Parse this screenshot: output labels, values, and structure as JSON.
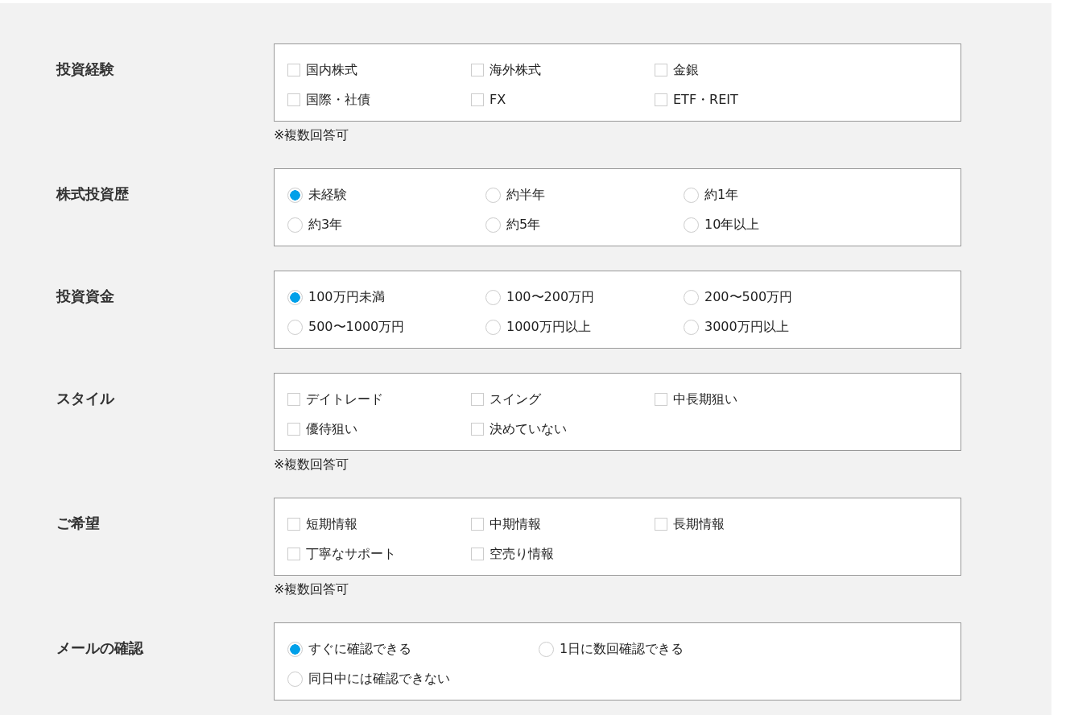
{
  "sections": [
    {
      "label": "投資経験",
      "kind": "checkbox",
      "note": "※複数回答可",
      "options": [
        {
          "label": "国内株式",
          "checked": false
        },
        {
          "label": "海外株式",
          "checked": false
        },
        {
          "label": "金銀",
          "checked": false
        },
        {
          "label": "国際・社債",
          "checked": false
        },
        {
          "label": "FX",
          "checked": false
        },
        {
          "label": "ETF・REIT",
          "checked": false
        }
      ]
    },
    {
      "label": "株式投資歴",
      "kind": "radio",
      "options": [
        {
          "label": "未経験",
          "selected": true
        },
        {
          "label": "約半年",
          "selected": false
        },
        {
          "label": "約1年",
          "selected": false
        },
        {
          "label": "約3年",
          "selected": false
        },
        {
          "label": "約5年",
          "selected": false
        },
        {
          "label": "10年以上",
          "selected": false
        }
      ]
    },
    {
      "label": "投資資金",
      "kind": "radio",
      "options": [
        {
          "label": "100万円未満",
          "selected": true
        },
        {
          "label": "100〜200万円",
          "selected": false
        },
        {
          "label": "200〜500万円",
          "selected": false
        },
        {
          "label": "500〜1000万円",
          "selected": false
        },
        {
          "label": "1000万円以上",
          "selected": false
        },
        {
          "label": "3000万円以上",
          "selected": false
        }
      ]
    },
    {
      "label": "スタイル",
      "kind": "checkbox",
      "note": "※複数回答可",
      "options": [
        {
          "label": "デイトレード",
          "checked": false
        },
        {
          "label": "スイング",
          "checked": false
        },
        {
          "label": "中長期狙い",
          "checked": false
        },
        {
          "label": "優待狙い",
          "checked": false
        },
        {
          "label": "決めていない",
          "checked": false
        }
      ]
    },
    {
      "label": "ご希望",
      "kind": "checkbox",
      "note": "※複数回答可",
      "options": [
        {
          "label": "短期情報",
          "checked": false
        },
        {
          "label": "中期情報",
          "checked": false
        },
        {
          "label": "長期情報",
          "checked": false
        },
        {
          "label": "丁寧なサポート",
          "checked": false
        },
        {
          "label": "空売り情報",
          "checked": false
        }
      ]
    },
    {
      "label": "メールの確認",
      "kind": "radio",
      "options": [
        {
          "label": "すぐに確認できる",
          "selected": true
        },
        {
          "label": "1日に数回確認できる",
          "selected": false
        },
        {
          "label": "同日中には確認できない",
          "selected": false
        }
      ]
    }
  ]
}
